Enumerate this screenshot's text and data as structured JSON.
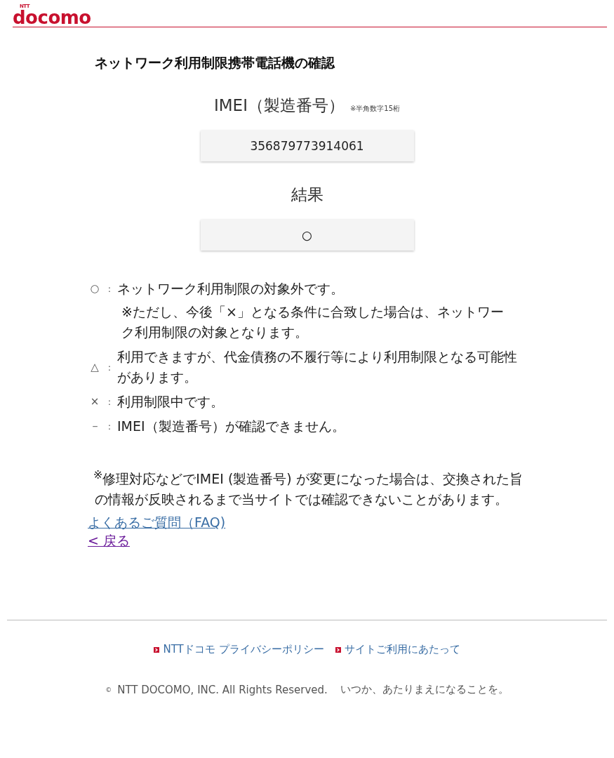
{
  "header": {
    "logo_small": "NTT",
    "logo": "docomo"
  },
  "title": "ネットワーク利用制限携帯電話機の確認",
  "imei": {
    "label": "IMEI（製造番号）",
    "hint": "※半角数字15桁",
    "value": "356879773914061"
  },
  "result": {
    "label": "結果",
    "value": "○"
  },
  "legend": [
    {
      "symbol": "○",
      "sep": ":",
      "text": "ネットワーク利用制限の対象外です。",
      "note": "※ただし、今後「×」となる条件に合致した場合は、ネットワーク利用制限の対象となります。"
    },
    {
      "symbol": "△",
      "sep": ":",
      "text": "利用できますが、代金債務の不履行等により利用制限となる可能性があります。"
    },
    {
      "symbol": "×",
      "sep": ":",
      "text": "利用制限中です。"
    },
    {
      "symbol": "－",
      "sep": ":",
      "text": "IMEI（製造番号）が確認できません。"
    }
  ],
  "notice": "$^{※}$修理対応などでIMEI (製造番号) が変更になった場合は、交換された旨の情報が反映されるまで当サイトでは確認できないことがあります。",
  "links": [
    {
      "label": "よくあるご質問（FAQ)",
      "visited": false
    },
    {
      "label": "< 戻る",
      "visited": true
    }
  ],
  "footer": {
    "links": [
      "NTTドコモ プライバシーポリシー",
      "サイトご利用にあたって"
    ],
    "copyright_mark": "©",
    "copyright": "NTT DOCOMO, INC. All Rights Reserved.",
    "slogan": "いつか、あたりまえになることを。"
  }
}
